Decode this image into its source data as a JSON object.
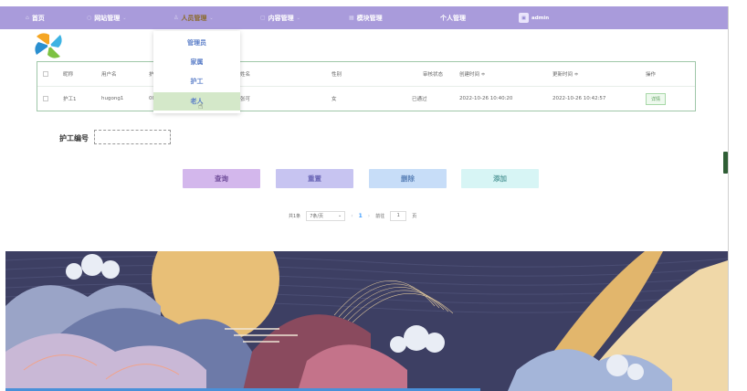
{
  "nav": {
    "items": [
      {
        "icon": "home-icon",
        "label": "首页",
        "chevron": false
      },
      {
        "icon": "globe-icon",
        "label": "网站管理",
        "chevron": true
      },
      {
        "icon": "user-icon",
        "label": "人员管理",
        "chevron": true,
        "active": true
      },
      {
        "icon": "document-icon",
        "label": "内容管理",
        "chevron": true
      },
      {
        "icon": "grid-icon",
        "label": "模块管理",
        "chevron": false
      },
      {
        "icon": "",
        "label": "个人管理",
        "chevron": false
      }
    ],
    "user_name": "admin"
  },
  "dropdown": {
    "items": [
      "管理员",
      "家属",
      "护工",
      "老人"
    ],
    "hovered_index": 3
  },
  "table": {
    "columns": [
      "昵称",
      "用户名",
      "护",
      "姓名",
      "性别",
      "审核状态",
      "创建时间 ≑",
      "更新时间 ≑",
      "操作"
    ],
    "rows": [
      {
        "nickname": "护工1",
        "username": "hugong1",
        "id_part": "00",
        "name": "张可",
        "gender": "女",
        "status": "已通过",
        "created": "2022-10-26 10:40:20",
        "updated": "2022-10-26 10:42:57",
        "action": "详情"
      }
    ]
  },
  "search": {
    "label": "护工编号",
    "value": "",
    "placeholder": ""
  },
  "buttons": {
    "query": "查询",
    "reset": "重置",
    "delete": "删除",
    "add": "添加"
  },
  "pager": {
    "total": "共1条",
    "page_size": "7条/页",
    "current_page": "1",
    "goto_label": "前往",
    "goto_value": "1",
    "page_suffix": "页"
  },
  "colors": {
    "navbar": "#a99bdb",
    "query_btn": "#d3b7ec",
    "reset_btn": "#c7c4f1",
    "delete_btn": "#c7ddf8",
    "add_btn": "#d7f5f5",
    "hover_item": "#d4e8c9"
  }
}
